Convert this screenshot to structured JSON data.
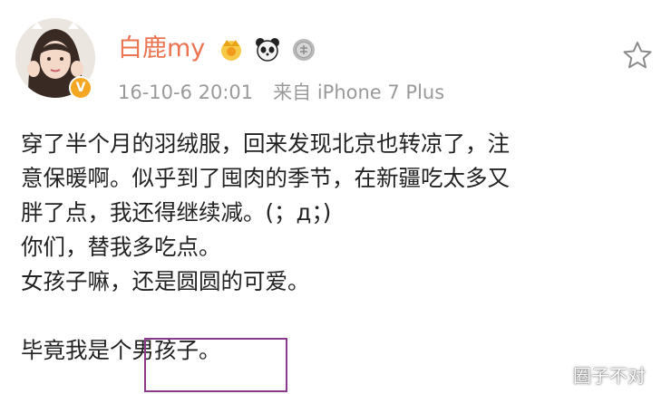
{
  "post": {
    "username": "白鹿my",
    "timestamp": "16-10-6 20:01",
    "source": "来自 iPhone 7 Plus",
    "icons": [
      "crown-badge-icon",
      "panda-badge-icon",
      "medal-badge-icon",
      "star-outline-icon",
      "verified-v-icon"
    ],
    "verified_mark": "V",
    "content_lines": [
      "穿了半个月的羽绒服，回来发现北京也转凉了，注",
      "意保暖啊。似乎到了囤肉的季节，在新疆吃太多又",
      "胖了点，我还得继续减。(；д；)",
      "你们，替我多吃点。",
      "女孩子嘛，还是圆圆的可爱。",
      "毕竟我是个男孩子。"
    ],
    "colors": {
      "username": "#eb7350",
      "meta_text": "#9a9a9a",
      "body_text": "#222222",
      "highlight_border": "#8a3a8a"
    }
  },
  "watermark": "圈子不对"
}
